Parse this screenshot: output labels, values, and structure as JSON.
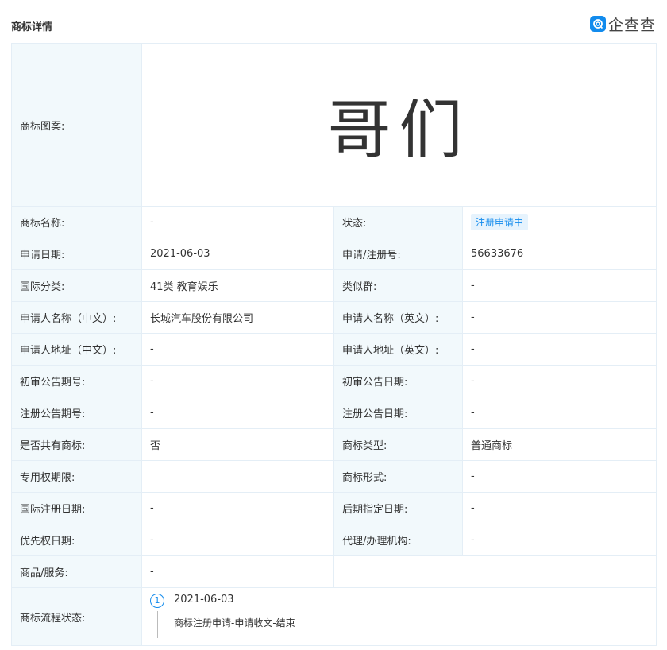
{
  "header": {
    "title": "商标详情",
    "brand": "企查查"
  },
  "logo": {
    "label": "商标图案:",
    "text": "哥们"
  },
  "rows": [
    {
      "l1": "商标名称:",
      "v1": "-",
      "l2": "状态:",
      "v2": "注册申请中"
    },
    {
      "l1": "申请日期:",
      "v1": "2021-06-03",
      "l2": "申请/注册号:",
      "v2": "56633676"
    },
    {
      "l1": "国际分类:",
      "v1": "41类 教育娱乐",
      "l2": "类似群:",
      "v2": "-"
    },
    {
      "l1": "申请人名称（中文）:",
      "v1": "长城汽车股份有限公司",
      "l2": "申请人名称（英文）:",
      "v2": "-"
    },
    {
      "l1": "申请人地址（中文）:",
      "v1": "-",
      "l2": "申请人地址（英文）:",
      "v2": "-"
    },
    {
      "l1": "初审公告期号:",
      "v1": "-",
      "l2": "初审公告日期:",
      "v2": "-"
    },
    {
      "l1": "注册公告期号:",
      "v1": "-",
      "l2": "注册公告日期:",
      "v2": "-"
    },
    {
      "l1": "是否共有商标:",
      "v1": "否",
      "l2": "商标类型:",
      "v2": "普通商标"
    },
    {
      "l1": "专用权期限:",
      "v1": "",
      "l2": "商标形式:",
      "v2": "-"
    },
    {
      "l1": "国际注册日期:",
      "v1": "-",
      "l2": "后期指定日期:",
      "v2": "-"
    },
    {
      "l1": "优先权日期:",
      "v1": "-",
      "l2": "代理/办理机构:",
      "v2": "-"
    }
  ],
  "goods": {
    "label": "商品/服务:",
    "value": "-"
  },
  "flow": {
    "label": "商标流程状态:",
    "step_num": "1",
    "date": "2021-06-03",
    "desc": "商标注册申请-申请收文-结束"
  },
  "colors": {
    "accent": "#128bed",
    "label_bg": "#f2f9fc",
    "border": "#e4eef6"
  }
}
